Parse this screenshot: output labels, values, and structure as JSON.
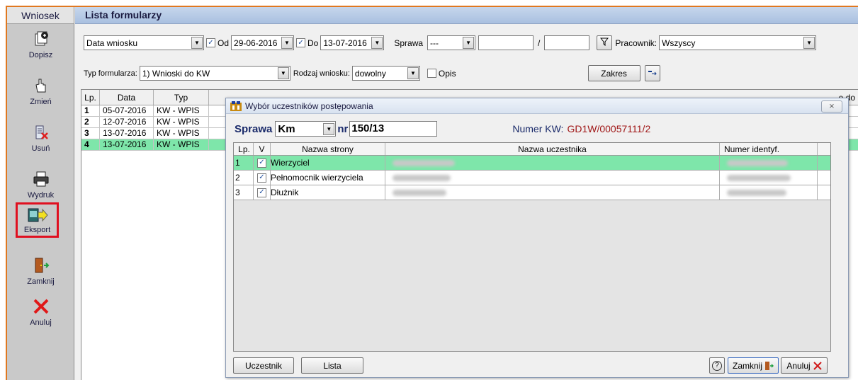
{
  "sidebar": {
    "title": "Wniosek",
    "tools": [
      {
        "label": "Dopisz",
        "icon": "add-document-icon"
      },
      {
        "label": "Zmień",
        "icon": "edit-hand-icon"
      },
      {
        "label": "Usuń",
        "icon": "delete-icon"
      },
      {
        "label": "Wydruk",
        "icon": "printer-icon"
      },
      {
        "label": "Eksport",
        "icon": "export-icon"
      },
      {
        "label": "Zamknij",
        "icon": "exit-door-icon"
      },
      {
        "label": "Anuluj",
        "icon": "cancel-x-icon"
      }
    ]
  },
  "main": {
    "title": "Lista formularzy",
    "filters": {
      "date_type": "Data wniosku",
      "od_label": "Od",
      "od_value": "29-06-2016",
      "do_label": "Do",
      "do_value": "13-07-2016",
      "sprawa_label": "Sprawa",
      "sprawa_value": "---",
      "slash": "/",
      "pracownik_label": "Pracownik:",
      "pracownik_value": "Wszyscy",
      "typ_label": "Typ formularza:",
      "typ_value": "1) Wnioski do KW",
      "rodzaj_label": "Rodzaj wniosku:",
      "rodzaj_value": "dowolny",
      "opis_label": "Opis",
      "zakres_label": "Zakres",
      "right_cut_text": "e do El"
    },
    "table": {
      "headers": [
        "Lp.",
        "Data",
        "Typ"
      ],
      "rows": [
        {
          "lp": "1",
          "date": "05-07-2016",
          "typ": "KW - WPIS"
        },
        {
          "lp": "2",
          "date": "12-07-2016",
          "typ": "KW - WPIS"
        },
        {
          "lp": "3",
          "date": "13-07-2016",
          "typ": "KW - WPIS"
        },
        {
          "lp": "4",
          "date": "13-07-2016",
          "typ": "KW - WPIS"
        }
      ]
    }
  },
  "dialog": {
    "title": "Wybór uczestników postępowania",
    "close_label": "⨯",
    "sprawa_label": "Sprawa",
    "sprawa_type": "Km",
    "nr_label": "nr",
    "nr_value": "150/13",
    "numer_kw_label": "Numer KW:",
    "numer_kw_value": "GD1W/00057111/2",
    "grid_headers": [
      "Lp.",
      "V",
      "Nazwa strony",
      "Nazwa uczestnika",
      "Numer identyf."
    ],
    "rows": [
      {
        "lp": "1",
        "strona": "Wierzyciel"
      },
      {
        "lp": "2",
        "strona": "Pełnomocnik wierzyciela"
      },
      {
        "lp": "3",
        "strona": "Dłużnik"
      }
    ],
    "btn_uczestnik": "Uczestnik",
    "btn_lista": "Lista",
    "btn_help": "?",
    "btn_zamknij": "Zamknij",
    "btn_anuluj": "Anuluj"
  },
  "colors": {
    "highlight_border": "#e01020",
    "selected_row": "#7ee6aa",
    "accent_orange": "#e07820"
  }
}
